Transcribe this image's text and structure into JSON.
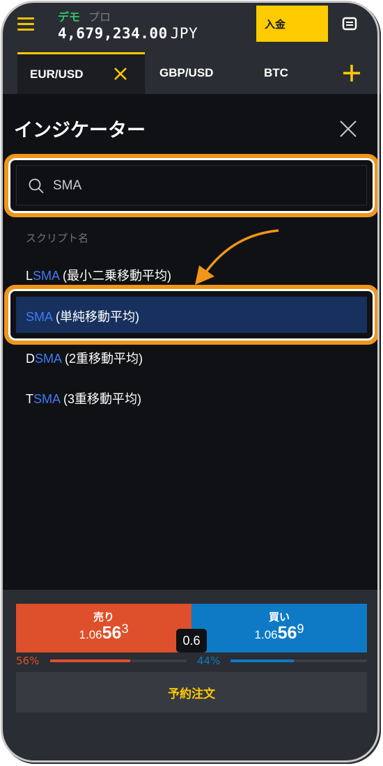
{
  "header": {
    "mode_demo": "デモ",
    "mode_pro": "プロ",
    "balance_value": "4,679,234.00",
    "balance_currency": "JPY",
    "deposit_label": "入金"
  },
  "tabs": [
    {
      "label": "EUR/USD",
      "active": true
    },
    {
      "label": "GBP/USD",
      "active": false
    },
    {
      "label": "BTC",
      "active": false
    }
  ],
  "panel": {
    "title": "インジケーター",
    "search_value": "SMA",
    "section_label": "スクリプト名",
    "results": [
      {
        "prefix": "L",
        "match": "SMA",
        "rest": " (最小二乗移動平均)",
        "selected": false
      },
      {
        "prefix": "",
        "match": "SMA",
        "rest": " (単純移動平均)",
        "selected": true
      },
      {
        "prefix": "D",
        "match": "SMA",
        "rest": " (2重移動平均)",
        "selected": false
      },
      {
        "prefix": "T",
        "match": "SMA",
        "rest": " (3重移動平均)",
        "selected": false
      }
    ]
  },
  "trade": {
    "sell_label": "売り",
    "sell_small": "1.06",
    "sell_big": "56",
    "sell_sup": "3",
    "buy_label": "買い",
    "buy_small": "1.06",
    "buy_big": "56",
    "buy_sup": "9",
    "spread": "0.6",
    "sell_pct": "56%",
    "buy_pct": "44%",
    "sell_ratio": 0.56,
    "buy_ratio": 0.44,
    "order_label": "予約注文"
  },
  "colors": {
    "accent_yellow": "#fdcb00",
    "sell_red": "#de4f2b",
    "buy_blue": "#0e7ac5",
    "highlight_orange": "#f0961b",
    "match_blue": "#3e7cf5"
  },
  "icons": [
    "menu-icon",
    "news-icon",
    "close-icon",
    "plus-icon",
    "search-icon",
    "arrow-annotation"
  ]
}
